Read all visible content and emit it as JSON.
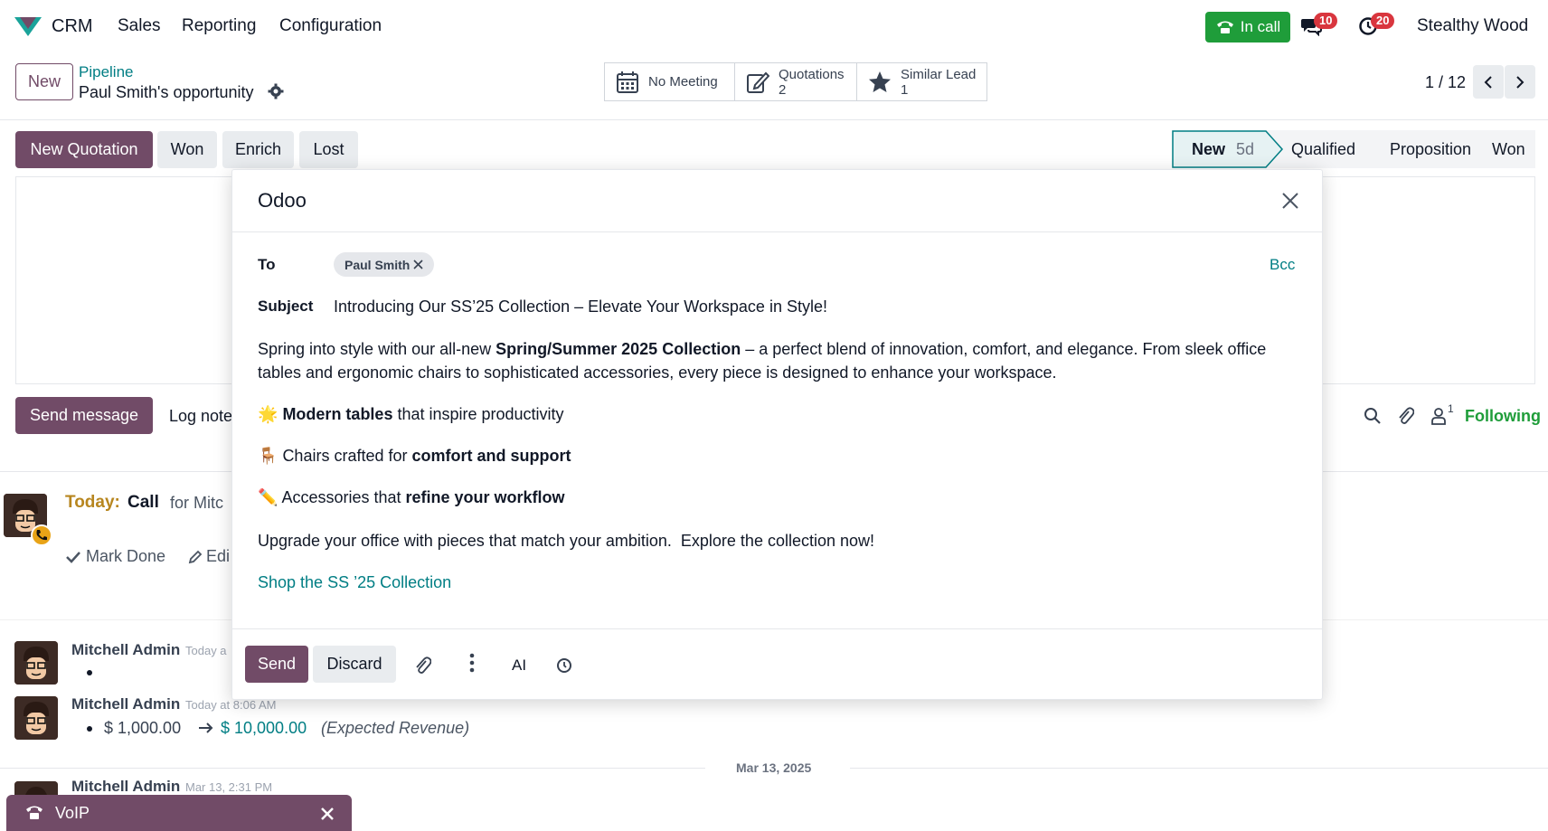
{
  "navbar": {
    "app_name": "CRM",
    "menu": [
      "Sales",
      "Reporting",
      "Configuration"
    ],
    "in_call_label": "In call",
    "messages_count": "10",
    "activities_count": "20",
    "user_name": "Stealthy Wood",
    "brand_color": "#714b67",
    "in_call_color": "#1f9d3a"
  },
  "control_panel": {
    "new_label": "New",
    "breadcrumb_parent": "Pipeline",
    "record_title": "Paul Smith's opportunity",
    "smart_buttons": [
      {
        "label": "No Meeting",
        "value": ""
      },
      {
        "label": "Quotations",
        "value": "2"
      },
      {
        "label": "Similar Lead",
        "value": "1"
      }
    ],
    "pager": "1 / 12"
  },
  "action_bar": {
    "new_quotation": "New Quotation",
    "won": "Won",
    "enrich": "Enrich",
    "lost": "Lost"
  },
  "stages": {
    "current": "New",
    "current_duration": "5d",
    "others": [
      "Qualified",
      "Proposition",
      "Won"
    ]
  },
  "chatter": {
    "send_message": "Send message",
    "log_note": "Log note",
    "followers_count": "1",
    "following_label": "Following",
    "activity": {
      "when": "Today:",
      "type": "Call",
      "summary": "for Mitc",
      "mark_done": "Mark Done",
      "edit": "Edi"
    },
    "messages": [
      {
        "author": "Mitchell Admin",
        "time": "Today a",
        "bullet": ""
      },
      {
        "author": "Mitchell Admin",
        "time": "Today at 8:06 AM",
        "old_value": "$ 1,000.00",
        "new_value": "$ 10,000.00",
        "field": "(Expected Revenue)"
      },
      {
        "author": "Mitchell Admin",
        "time": "Mar 13, 2:31 PM"
      }
    ],
    "date_separator": "Mar 13, 2025"
  },
  "modal": {
    "title": "Odoo",
    "to_label": "To",
    "recipient": "Paul Smith",
    "bcc_label": "Bcc",
    "subject_label": "Subject",
    "subject": "Introducing Our SS’25 Collection – Elevate Your Workspace in Style!",
    "body": {
      "p1_before": "Spring into style with our all-new ",
      "p1_bold": "Spring/Summer 2025 Collection",
      "p1_after": " – a perfect blend of innovation, comfort, and elegance. From sleek office",
      "p1_line2": "tables and ergonomic chairs to sophisticated accessories, every piece is designed to enhance your workspace.",
      "item1_emoji": "🌟",
      "item1_bold": "Modern tables",
      "item1_rest": " that inspire productivity",
      "item2_emoji": "🪑",
      "item2_text": "Chairs crafted for ",
      "item2_bold": "comfort and support",
      "item3_emoji": "✏️",
      "item3_text": "Accessories that ",
      "item3_bold": "refine your workflow",
      "closing": "Upgrade your office with pieces that match your ambition.  Explore the collection now!",
      "link": "Shop the SS ’25 Collection"
    },
    "send": "Send",
    "discard": "Discard",
    "ai_label": "AI"
  },
  "voip": {
    "label": "VoIP"
  }
}
